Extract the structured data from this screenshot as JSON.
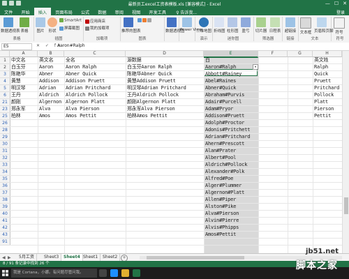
{
  "window": {
    "title": "最新员工excel工资表模板.xls [兼容模式] - Excel",
    "minimize": "—",
    "maximize": "☐",
    "close": "✕"
  },
  "ribbon_tabs": [
    "文件",
    "开始",
    "插入",
    "页面布局",
    "公式",
    "数据",
    "审阅",
    "视图",
    "开发工具"
  ],
  "ribbon_search": "♀ 告诉我...",
  "login": "登录",
  "ribbon": {
    "table_group": {
      "pivot": "数据透视表",
      "recommended": "推荐的数据透视表",
      "table": "表格",
      "label": "表格"
    },
    "illustrations": {
      "pictures": "图片",
      "online_pictures": "联机图片",
      "shapes": "形状",
      "smartart": "SmartArt",
      "screenshot": "屏幕截图",
      "label": "插图"
    },
    "addins": {
      "store": "应用商店",
      "my_addins": "我的加载项",
      "label": "加载项"
    },
    "charts": {
      "recommended": "推荐的图表",
      "label": "图表"
    },
    "pivotchart": "数据透视图",
    "powerview": "Power View",
    "tours": {
      "map": "三维地图",
      "label": "演示"
    },
    "sparklines": {
      "line": "折线图",
      "column": "柱形图",
      "winloss": "盈亏",
      "label": "迷你图"
    },
    "filters": {
      "slicer": "切片器",
      "timeline": "日程表",
      "label": "筛选器"
    },
    "links": {
      "hyperlink": "超链接",
      "label": "链接"
    },
    "text": {
      "textbox": "文本框",
      "header": "页眉和页脚",
      "label": "文本"
    },
    "symbols": {
      "symbol": "符号",
      "label": "符号"
    }
  },
  "formula_bar": {
    "name_box": "E5",
    "fx": "✕ ✓ fx",
    "formula": "Aaron#Ralph"
  },
  "columns": [
    "A",
    "B",
    "C",
    "D",
    "E",
    "F",
    "G",
    "H"
  ],
  "rows": [
    {
      "num": "1",
      "a": "中文名",
      "b": "英文名",
      "c": "全名",
      "d": "源数据",
      "e": "白",
      "h": "英文姓"
    },
    {
      "num": "2",
      "a": "白玉芬",
      "b": "Aaron",
      "c": "Aaron Ralph",
      "d": "白玉芬Aaron Ralph",
      "e": "Aaron#Ralph",
      "h": "Ralph"
    },
    {
      "num": "3",
      "a": "陈艳华",
      "b": "Abner",
      "c": "Abner Quick",
      "d": "陈艳华Abner Quick",
      "e": "Abbott#Rainey",
      "h": "Quick"
    },
    {
      "num": "4",
      "a": "黄慧",
      "b": "Addison",
      "c": "Addison Pruett",
      "d": "黄慧Addison Pruett",
      "e": "Abel#Raines",
      "h": "Pruett"
    },
    {
      "num": "5",
      "a": "明汉琴",
      "b": "Adrian",
      "c": "Adrian Pritchard",
      "d": "明汉琴Adrian Pritchard",
      "e": "Abner#Quick",
      "h": "Pritchard"
    },
    {
      "num": "6",
      "a": "王丹",
      "b": "Aldrich",
      "c": "Aldrich Pollock",
      "d": "王丹Aldrich Pollock",
      "e": "Abraham#Purvis",
      "h": "Pollock"
    },
    {
      "num": "21",
      "a": "颜刚",
      "b": "Algernon",
      "c": "Algernon Platt",
      "d": "颜刚Algernon Platt",
      "e": "Adair#Purcell",
      "h": "Platt"
    },
    {
      "num": "23",
      "a": "郑永军",
      "b": "Alva",
      "c": "Alva Pierson",
      "d": "郑永军Alva Pierson",
      "e": "Adam#Pryor",
      "h": "Pierson"
    },
    {
      "num": "25",
      "a": "柏林",
      "b": "Amos",
      "c": "Amos Pettit",
      "d": "柏林Amos Pettit",
      "e": "Addison#Pruett",
      "h": "Pettit"
    },
    {
      "num": "26",
      "e": "Adolph#Proctor"
    },
    {
      "num": "28",
      "e": "Adonis#Pritchett"
    },
    {
      "num": "29",
      "e": "Adrian#Pritchard"
    },
    {
      "num": "30",
      "e": "Ahern#Prescott"
    },
    {
      "num": "31",
      "e": "Alan#Prater"
    },
    {
      "num": "32",
      "e": "Albert#Pool"
    },
    {
      "num": "33",
      "e": "Aldrich#Pollock"
    },
    {
      "num": "34",
      "e": "Alexander#Polk"
    },
    {
      "num": "35",
      "e": "Alfred#Poe"
    },
    {
      "num": "36",
      "e": "Alger#Plummer"
    },
    {
      "num": "37",
      "e": "Algernon#Platt"
    },
    {
      "num": "38",
      "e": "Allen#Piper"
    },
    {
      "num": "39",
      "e": "Alston#Pike"
    },
    {
      "num": "40",
      "e": "Alva#Pierson"
    },
    {
      "num": "41",
      "e": "Alvin#Pierre"
    },
    {
      "num": "42",
      "e": "Alvis#Phipps"
    },
    {
      "num": "43",
      "e": "Amos#Pettit"
    },
    {
      "num": "91",
      "e": ""
    }
  ],
  "sheet_tabs": [
    "5月工资",
    "Sheet3",
    "Sheet4",
    "Sheet1",
    "Sheet2"
  ],
  "active_sheet": "Sheet4",
  "add_sheet": "+",
  "status": "8 / 91 条记录中找到 26 个",
  "taskbar": {
    "search": "我是 Cortana，小娜。有问题尽管问我。"
  },
  "watermark": {
    "site": "jb51.net",
    "brand": "脚本之家"
  },
  "colors": {
    "excel_green": "#217346",
    "column_selection": "#d9d9d9"
  }
}
